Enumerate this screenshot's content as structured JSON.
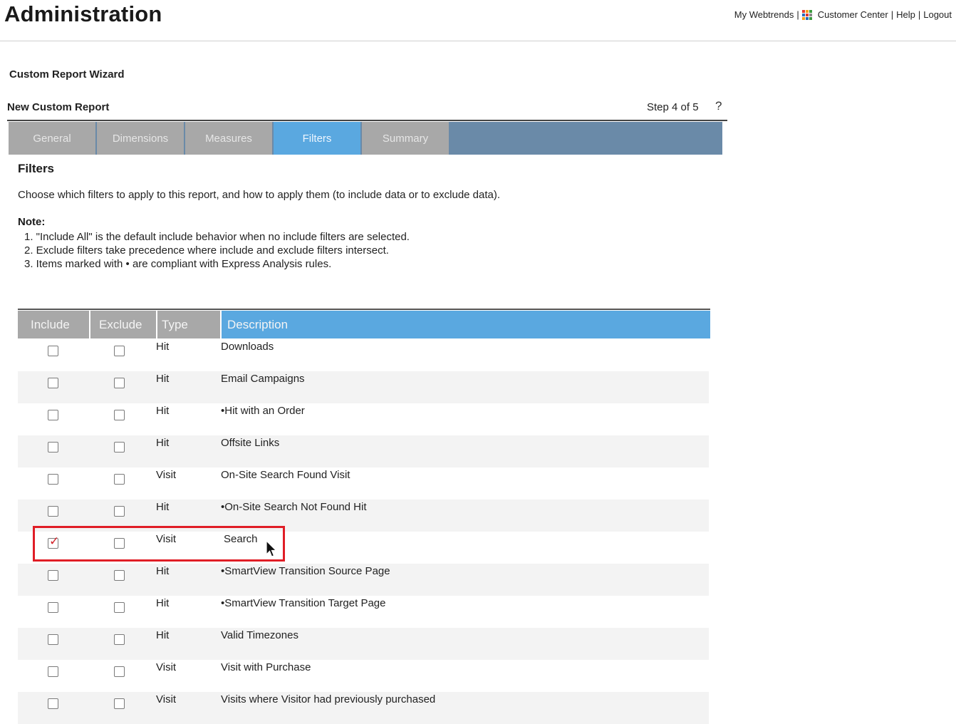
{
  "header": {
    "title": "Administration",
    "links": [
      "My Webtrends",
      "Customer Center",
      "Help",
      "Logout"
    ],
    "grid_icon_colors": [
      "#e23b2e",
      "#f4a21c",
      "#3b9b3f",
      "#2a6ebb",
      "#e23b2e",
      "#8a8a8a",
      "#f4a21c",
      "#2a6ebb",
      "#3b9b3f"
    ]
  },
  "wizard": {
    "title": "Custom Report Wizard",
    "report_title": "New Custom Report",
    "step": "Step 4 of 5",
    "help": "?"
  },
  "tabs": [
    {
      "label": "General",
      "active": false
    },
    {
      "label": "Dimensions",
      "active": false
    },
    {
      "label": "Measures",
      "active": false
    },
    {
      "label": "Filters",
      "active": true
    },
    {
      "label": "Summary",
      "active": false
    }
  ],
  "content": {
    "section_title": "Filters",
    "intro": "Choose which filters to apply to this report, and how to apply them (to include data or to exclude data).",
    "note_label": "Note:",
    "notes": [
      "1. \"Include All\" is the default include behavior when no include filters are selected.",
      "2. Exclude filters take precedence where include and exclude filters intersect.",
      "3. Items marked with • are compliant with Express Analysis rules."
    ]
  },
  "table": {
    "headers": {
      "include": "Include",
      "exclude": "Exclude",
      "type": "Type",
      "description": "Description"
    },
    "rows": [
      {
        "type": "Hit",
        "description": "Downloads",
        "include": false,
        "exclude": false
      },
      {
        "type": "Hit",
        "description": "Email Campaigns",
        "include": false,
        "exclude": false
      },
      {
        "type": "Hit",
        "description": "•Hit with an Order",
        "include": false,
        "exclude": false
      },
      {
        "type": "Hit",
        "description": "Offsite Links",
        "include": false,
        "exclude": false
      },
      {
        "type": "Visit",
        "description": "On-Site Search Found Visit",
        "include": false,
        "exclude": false
      },
      {
        "type": "Hit",
        "description": "•On-Site Search Not Found Hit",
        "include": false,
        "exclude": false
      },
      {
        "type": "Visit",
        "description": "Search",
        "include": true,
        "exclude": false
      },
      {
        "type": "Hit",
        "description": "•SmartView Transition Source Page",
        "include": false,
        "exclude": false
      },
      {
        "type": "Hit",
        "description": "•SmartView Transition Target Page",
        "include": false,
        "exclude": false
      },
      {
        "type": "Hit",
        "description": "Valid Timezones",
        "include": false,
        "exclude": false
      },
      {
        "type": "Visit",
        "description": "Visit with Purchase",
        "include": false,
        "exclude": false
      },
      {
        "type": "Visit",
        "description": "Visits where Visitor had previously purchased",
        "include": false,
        "exclude": false
      }
    ]
  },
  "colors": {
    "active_tab": "#5aa8e0",
    "inactive_tab": "#a8a8a8",
    "tab_bar": "#6a8aa8",
    "highlight": "#e01d26",
    "check": "#d2232a"
  }
}
